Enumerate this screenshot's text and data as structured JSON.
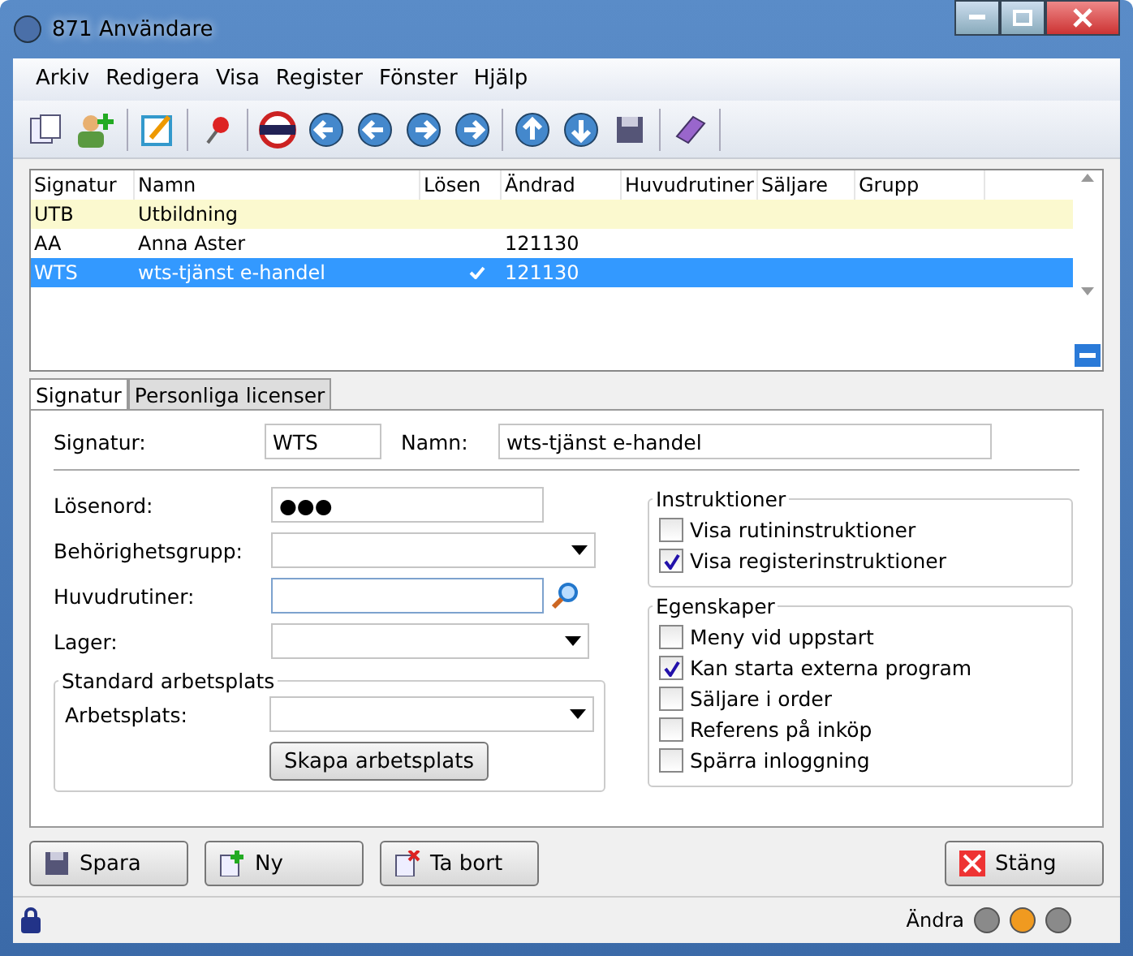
{
  "window": {
    "title": "871 Användare"
  },
  "menu": [
    "Arkiv",
    "Redigera",
    "Visa",
    "Register",
    "Fönster",
    "Hjälp"
  ],
  "table": {
    "columns": [
      "Signatur",
      "Namn",
      "Lösen",
      "Ändrad",
      "Huvudrutiner",
      "Säljare",
      "Grupp"
    ],
    "rows": [
      {
        "cells": [
          "UTB",
          "Utbildning",
          "",
          ""
        ],
        "password": false,
        "highlighted": true,
        "selected": false
      },
      {
        "cells": [
          "AA",
          "Anna Aster",
          "",
          "121130"
        ],
        "password": false,
        "highlighted": false,
        "selected": false
      },
      {
        "cells": [
          "WTS",
          "wts-tjänst e-handel",
          "",
          "121130"
        ],
        "password": true,
        "highlighted": false,
        "selected": true
      }
    ]
  },
  "tabs": [
    {
      "label": "Signatur",
      "selected": true
    },
    {
      "label": "Personliga licenser",
      "selected": false
    }
  ],
  "form": {
    "signatur_label": "Signatur:",
    "signatur": "WTS",
    "namn_label": "Namn:",
    "namn": "wts-tjänst e-handel",
    "fields": [
      {
        "label": "Lösenord:",
        "kind": "password",
        "value": "●●●"
      },
      {
        "label": "Behörighetsgrupp:",
        "kind": "dropdown"
      },
      {
        "label": "Huvudrutiner:",
        "kind": "search"
      },
      {
        "label": "Lager:",
        "kind": "dropdown"
      }
    ],
    "workplace_group": "Standard arbetsplats",
    "workplace_label": "Arbetsplats:",
    "create_button": "Skapa arbetsplats"
  },
  "instructions": {
    "title": "Instruktioner",
    "items": [
      {
        "label": "Visa rutininstruktioner",
        "checked": false
      },
      {
        "label": "Visa registerinstruktioner",
        "checked": true
      }
    ]
  },
  "properties": {
    "title": "Egenskaper",
    "items": [
      {
        "label": "Meny vid uppstart",
        "checked": false
      },
      {
        "label": "Kan starta externa program",
        "checked": true
      },
      {
        "label": "Säljare i order",
        "checked": false
      },
      {
        "label": "Referens på inköp",
        "checked": false
      },
      {
        "label": "Spärra inloggning",
        "checked": false
      }
    ]
  },
  "buttons": [
    {
      "label": "Spara",
      "kind": "save"
    },
    {
      "label": "Ny",
      "kind": "new"
    },
    {
      "label": "Ta bort",
      "kind": "delete"
    }
  ],
  "close_button": "Stäng",
  "status": {
    "mode": "Ändra",
    "lights": [
      {
        "color": "#8a8a8a"
      },
      {
        "color": "#f09a20"
      },
      {
        "color": "#8a8a8a"
      }
    ]
  }
}
